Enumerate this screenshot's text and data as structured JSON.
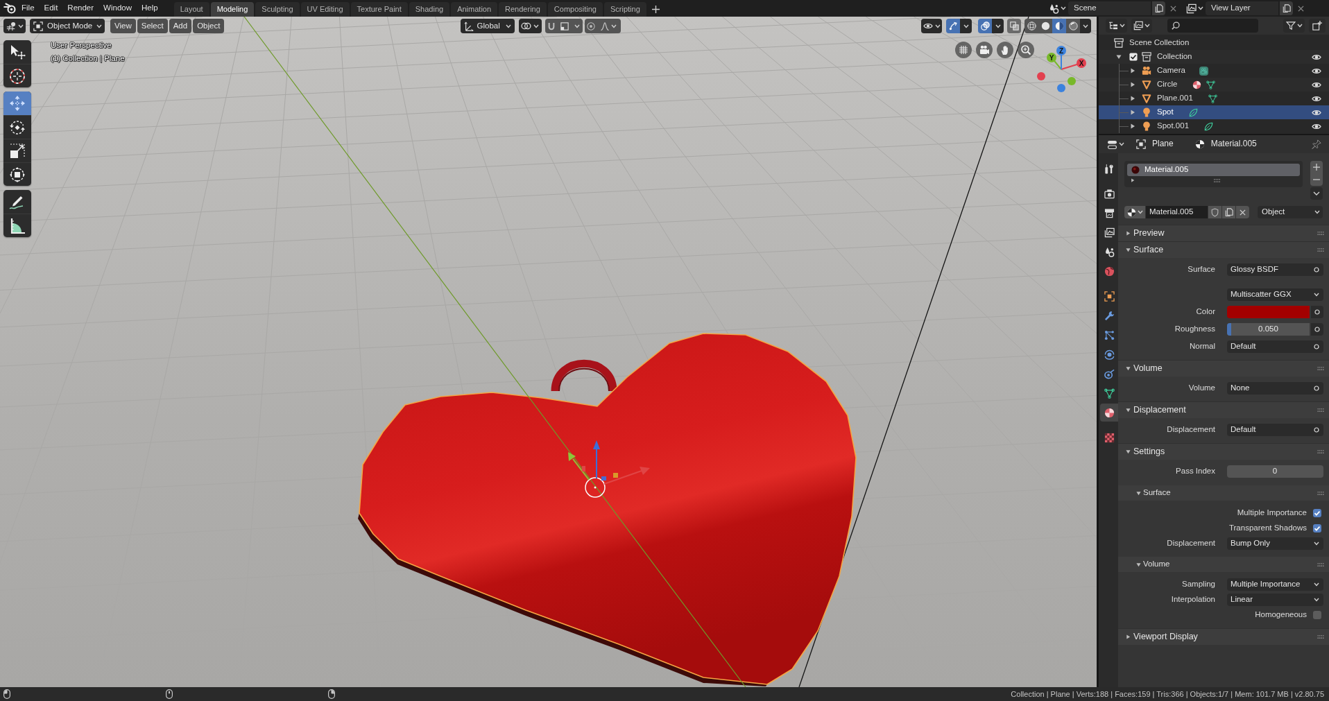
{
  "top_bar": {
    "menus": [
      "File",
      "Edit",
      "Render",
      "Window",
      "Help"
    ],
    "workspaces": [
      {
        "label": "Layout",
        "selected": false
      },
      {
        "label": "Modeling",
        "selected": true
      },
      {
        "label": "Sculpting",
        "selected": false
      },
      {
        "label": "UV Editing",
        "selected": false
      },
      {
        "label": "Texture Paint",
        "selected": false
      },
      {
        "label": "Shading",
        "selected": false
      },
      {
        "label": "Animation",
        "selected": false
      },
      {
        "label": "Rendering",
        "selected": false
      },
      {
        "label": "Compositing",
        "selected": false
      },
      {
        "label": "Scripting",
        "selected": false
      }
    ],
    "scene": "Scene",
    "view_layer": "View Layer"
  },
  "viewport": {
    "mode": "Object Mode",
    "menus": [
      "View",
      "Select",
      "Add",
      "Object"
    ],
    "orientation": "Global",
    "toggles": [
      {
        "kind": "gizmos",
        "on": true
      },
      {
        "kind": "overlays",
        "on": true
      },
      {
        "kind": "xray",
        "on": false
      }
    ],
    "shading": [
      {
        "kind": "wireframe",
        "selected": false
      },
      {
        "kind": "solid",
        "selected": false
      },
      {
        "kind": "material",
        "selected": true
      },
      {
        "kind": "rendered",
        "selected": false
      }
    ],
    "info": [
      "User Perspective",
      "(1) Collection | Plane"
    ],
    "tool_groups": [
      {
        "tools": [
          {
            "kind": "select",
            "selected": false
          },
          {
            "kind": "cursor",
            "selected": false
          }
        ]
      },
      {
        "tools": [
          {
            "kind": "move",
            "selected": true
          },
          {
            "kind": "rotate",
            "selected": false
          },
          {
            "kind": "scale",
            "selected": false
          },
          {
            "kind": "transform",
            "selected": false
          }
        ]
      },
      {
        "tools": [
          {
            "kind": "annotate",
            "selected": false
          },
          {
            "kind": "measure",
            "selected": false
          }
        ]
      }
    ],
    "axes": [
      {
        "label": "X",
        "color": "#e2404f"
      },
      {
        "label": "Y",
        "color": "#78b82a"
      },
      {
        "label": "Z",
        "color": "#3b82de"
      }
    ]
  },
  "outliner": {
    "root": "Scene Collection",
    "items": [
      {
        "label": "Collection",
        "checked": true,
        "expanded": true,
        "visible": true,
        "selected": false,
        "children": [
          {
            "label": "Camera",
            "kind": "camera",
            "expanded": false,
            "selected": false,
            "visible": true,
            "material": false,
            "data_active": true
          },
          {
            "label": "Circle",
            "kind": "mesh",
            "expanded": false,
            "selected": false,
            "visible": true,
            "material": true,
            "data_active": false
          },
          {
            "label": "Plane.001",
            "kind": "mesh",
            "expanded": false,
            "selected": false,
            "visible": true,
            "material": false,
            "data_active": false
          },
          {
            "label": "Spot",
            "kind": "light",
            "expanded": false,
            "selected": true,
            "visible": true,
            "material": false,
            "data_active": false
          },
          {
            "label": "Spot.001",
            "kind": "light",
            "expanded": false,
            "selected": false,
            "visible": true,
            "material": false,
            "data_active": false
          }
        ]
      }
    ]
  },
  "properties": {
    "breadcrumbs": [
      {
        "kind": "object",
        "label": "Plane"
      },
      {
        "kind": "material",
        "label": "Material.005"
      }
    ],
    "tab_groups": [
      {
        "tabs": [
          {
            "kind": "tool",
            "selected": false
          }
        ]
      },
      {
        "tabs": [
          {
            "kind": "render",
            "selected": false
          },
          {
            "kind": "output",
            "selected": false
          },
          {
            "kind": "view_layer",
            "selected": false
          },
          {
            "kind": "scene",
            "selected": false
          },
          {
            "kind": "world",
            "selected": false
          }
        ]
      },
      {
        "tabs": [
          {
            "kind": "object",
            "selected": false
          },
          {
            "kind": "modifiers",
            "selected": false
          },
          {
            "kind": "particles",
            "selected": false
          },
          {
            "kind": "physics",
            "selected": false
          },
          {
            "kind": "constraints",
            "selected": false
          },
          {
            "kind": "data",
            "selected": false
          },
          {
            "kind": "material",
            "selected": true
          }
        ]
      },
      {
        "tabs": [
          {
            "kind": "texture",
            "selected": false
          }
        ]
      }
    ],
    "slots": [
      {
        "label": "Material.005",
        "selected": true
      }
    ],
    "material": {
      "name": "Material.005",
      "link": "Object"
    },
    "panels": [
      {
        "title": "Preview",
        "expanded": false
      },
      {
        "title": "Surface",
        "expanded": true,
        "rows": [
          {
            "kind": "socket",
            "label": "Surface",
            "value": "Glossy BSDF"
          },
          {
            "kind": "dropdown",
            "value": "Multiscatter GGX"
          },
          {
            "kind": "color",
            "label": "Color",
            "color": "#a30000"
          },
          {
            "kind": "slider",
            "label": "Roughness",
            "value": "0.050",
            "level": 0.05
          },
          {
            "kind": "socket",
            "label": "Normal",
            "value": "Default"
          }
        ]
      },
      {
        "title": "Volume",
        "expanded": true,
        "rows": [
          {
            "kind": "socket",
            "label": "Volume",
            "value": "None"
          }
        ]
      },
      {
        "title": "Displacement",
        "expanded": true,
        "rows": [
          {
            "kind": "socket",
            "label": "Displacement",
            "value": "Default"
          }
        ]
      },
      {
        "title": "Settings",
        "expanded": true,
        "rows": [
          {
            "kind": "number",
            "label": "Pass Index",
            "value": "0"
          }
        ],
        "subpanels": [
          {
            "title": "Surface",
            "expanded": true,
            "rows": [
              {
                "kind": "checkbox",
                "label": "Multiple Importance",
                "checked": true
              },
              {
                "kind": "checkbox",
                "label": "Transparent Shadows",
                "checked": true
              },
              {
                "kind": "dropdown",
                "label": "Displacement",
                "value": "Bump Only"
              }
            ]
          },
          {
            "title": "Volume",
            "expanded": true,
            "rows": [
              {
                "kind": "dropdown",
                "label": "Sampling",
                "value": "Multiple Importance"
              },
              {
                "kind": "dropdown",
                "label": "Interpolation",
                "value": "Linear"
              },
              {
                "kind": "checkbox",
                "label": "Homogeneous",
                "checked": false
              }
            ]
          }
        ]
      },
      {
        "title": "Viewport Display",
        "expanded": false
      }
    ]
  },
  "status_bar": {
    "text": "Collection | Plane | Verts:188 | Faces:159 | Tris:366 | Objects:1/7 | Mem: 101.7 MB | v2.80.75"
  }
}
